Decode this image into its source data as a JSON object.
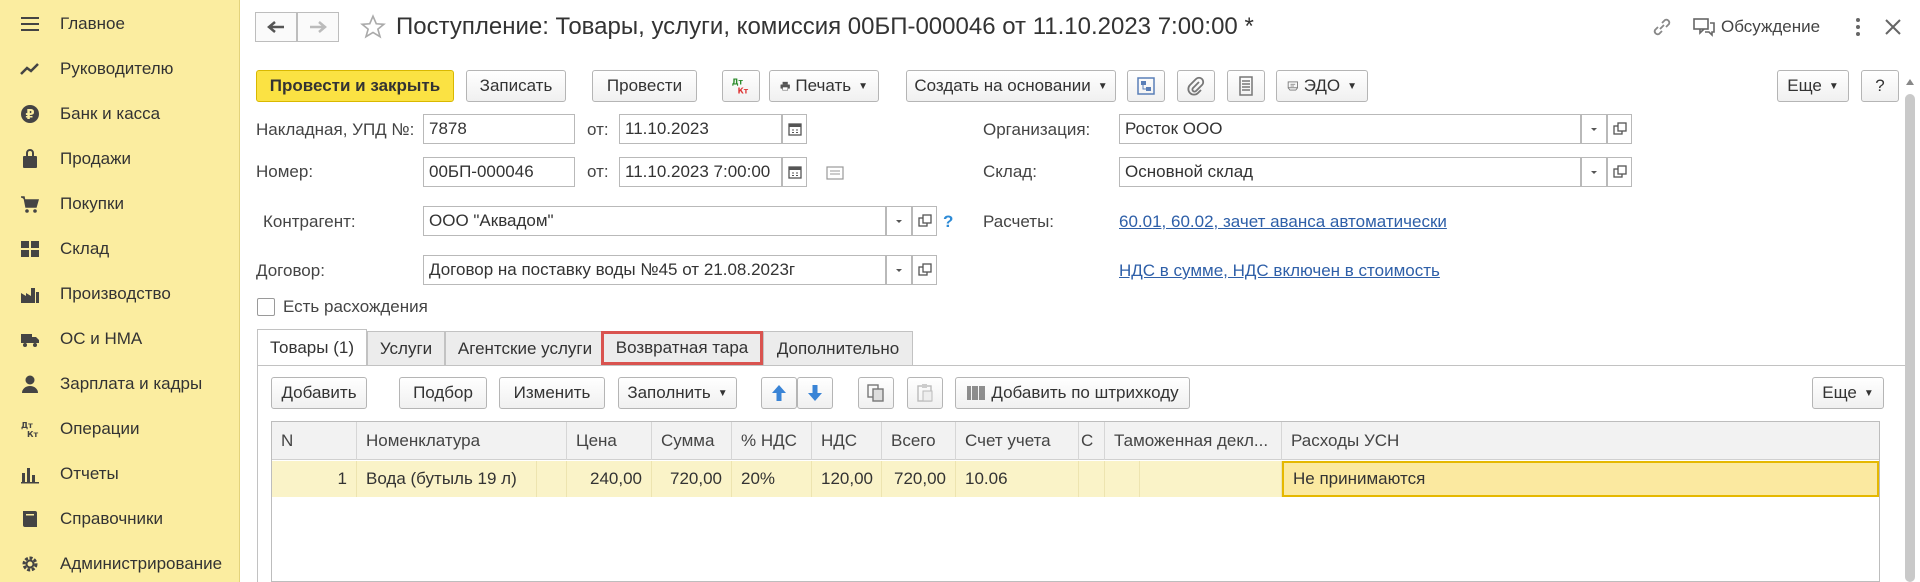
{
  "sidebar": {
    "items": [
      {
        "label": "Главное",
        "icon": "menu-icon"
      },
      {
        "label": "Руководителю",
        "icon": "trend-icon"
      },
      {
        "label": "Банк и касса",
        "icon": "ruble-icon"
      },
      {
        "label": "Продажи",
        "icon": "bag-icon"
      },
      {
        "label": "Покупки",
        "icon": "cart-icon"
      },
      {
        "label": "Склад",
        "icon": "warehouse-icon"
      },
      {
        "label": "Производство",
        "icon": "factory-icon"
      },
      {
        "label": "ОС и НМА",
        "icon": "truck-icon"
      },
      {
        "label": "Зарплата и кадры",
        "icon": "person-icon"
      },
      {
        "label": "Операции",
        "icon": "dtkt-icon"
      },
      {
        "label": "Отчеты",
        "icon": "bar-chart-icon"
      },
      {
        "label": "Справочники",
        "icon": "book-icon"
      },
      {
        "label": "Администрирование",
        "icon": "gear-icon"
      }
    ]
  },
  "header": {
    "title": "Поступление: Товары, услуги, комиссия 00БП-000046 от 11.10.2023 7:00:00 *",
    "discussion_label": "Обсуждение"
  },
  "toolbar": {
    "post_close": "Провести и закрыть",
    "save": "Записать",
    "post": "Провести",
    "dtkt": "Дт Кт",
    "print": "Печать",
    "create_based": "Создать на основании",
    "edo": "ЭДО",
    "more": "Еще",
    "help": "?"
  },
  "form": {
    "invoice_label": "Накладная, УПД №:",
    "invoice_value": "7878",
    "from_label": "от:",
    "invoice_date": "11.10.2023",
    "number_label": "Номер:",
    "number_value": "00БП-000046",
    "number_date": "11.10.2023  7:00:00",
    "org_label": "Организация:",
    "org_value": "Росток ООО",
    "warehouse_label": "Склад:",
    "warehouse_value": "Основной склад",
    "counterparty_label": "Контрагент:",
    "counterparty_value": "ООО \"Аквадом\"",
    "help_mark": "?",
    "settlements_label": "Расчеты:",
    "settlements_link": "60.01, 60.02, зачет аванса автоматически",
    "contract_label": "Договор:",
    "contract_value": "Договор на поставку воды №45 от 21.08.2023г",
    "vat_link": "НДС в сумме, НДС включен в стоимость",
    "discrepancy_label": "Есть расхождения"
  },
  "tabs": [
    {
      "label": "Товары (1)",
      "active": true
    },
    {
      "label": "Услуги"
    },
    {
      "label": "Агентские услуги"
    },
    {
      "label": "Возвратная тара",
      "highlighted": true
    },
    {
      "label": "Дополнительно"
    }
  ],
  "table_toolbar": {
    "add": "Добавить",
    "pick": "Подбор",
    "edit": "Изменить",
    "fill": "Заполнить",
    "barcode": "Добавить по штрихкоду",
    "more": "Еще"
  },
  "table": {
    "columns": [
      "N",
      "Номенклатура",
      "Цена",
      "Сумма",
      "% НДС",
      "НДС",
      "Всего",
      "Счет учета",
      "С",
      "Таможенная декл...",
      "Расходы УСН"
    ],
    "rows": [
      {
        "n": "1",
        "item": "Вода (бутыль 19 л)",
        "price": "240,00",
        "sum": "720,00",
        "vat_rate": "20%",
        "vat": "120,00",
        "total": "720,00",
        "account": "10.06",
        "usn": "Не принимаются"
      }
    ]
  },
  "colors": {
    "sidebar_bg": "#fbeda0",
    "primary_button": "#fbe243",
    "link": "#2e5fa8",
    "highlight_border": "#d9534f",
    "selected_row": "#faf3c8"
  }
}
